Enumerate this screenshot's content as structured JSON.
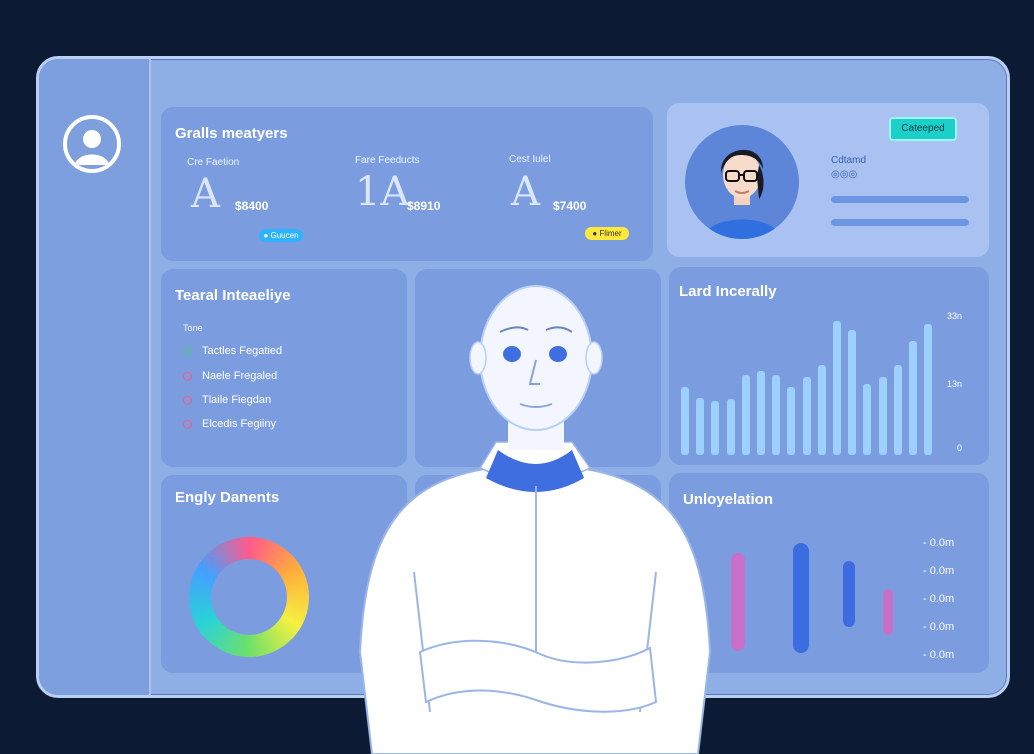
{
  "cards": {
    "metrics": {
      "title": "Gralls meatyers",
      "items": [
        {
          "label": "Cre Faetion",
          "glyph": "A",
          "value": "$8400"
        },
        {
          "label": "Fare Feeducts",
          "glyph": "1A",
          "value": "$8910"
        },
        {
          "label": "Cest Iulel",
          "glyph": "A",
          "value": "$7400"
        }
      ],
      "pill_blue": "● Guucen",
      "pill_yellow": "● Flimer"
    },
    "profile": {
      "button": "Cateeped",
      "name": "Cdtamd",
      "rating": "◎◎◎"
    },
    "inventory": {
      "title": "Tearal Inteaeliye",
      "sub": "Tone",
      "items": [
        {
          "label": "Tactles Fegatied",
          "color": "#3ed26d"
        },
        {
          "label": "Naele Fregaled",
          "color": "#ff5a7a"
        },
        {
          "label": "Tlaile Fiegdan",
          "color": "#ff5a7a"
        },
        {
          "label": "Elcedis Fegiiny",
          "color": "#ff5a7a"
        }
      ]
    },
    "bars": {
      "title": "Lard Incerally",
      "tick_top": "33n",
      "tick_mid": "13n",
      "tick_zero": "0"
    },
    "energy": {
      "title": "Engly Danents"
    },
    "unemployment": {
      "title": "Unloyelation",
      "labels": [
        "- 0.0m",
        "- 0.0m",
        "- 0.0m",
        "- 0.0m",
        "- 0.0m"
      ]
    }
  },
  "chart_data": {
    "type": "bar",
    "title": "Lard Incerally",
    "values": [
      0.45,
      0.38,
      0.36,
      0.37,
      0.53,
      0.56,
      0.53,
      0.45,
      0.52,
      0.6,
      0.89,
      0.83,
      0.47,
      0.52,
      0.6,
      0.76,
      0.87
    ],
    "ylim": [
      0,
      1
    ]
  },
  "colors": {
    "background": "#0c1a33",
    "panel": "#8eaee6",
    "card": "#7b9de0",
    "bar": "#9ed0ff",
    "accent_teal": "#1bd0c8"
  }
}
